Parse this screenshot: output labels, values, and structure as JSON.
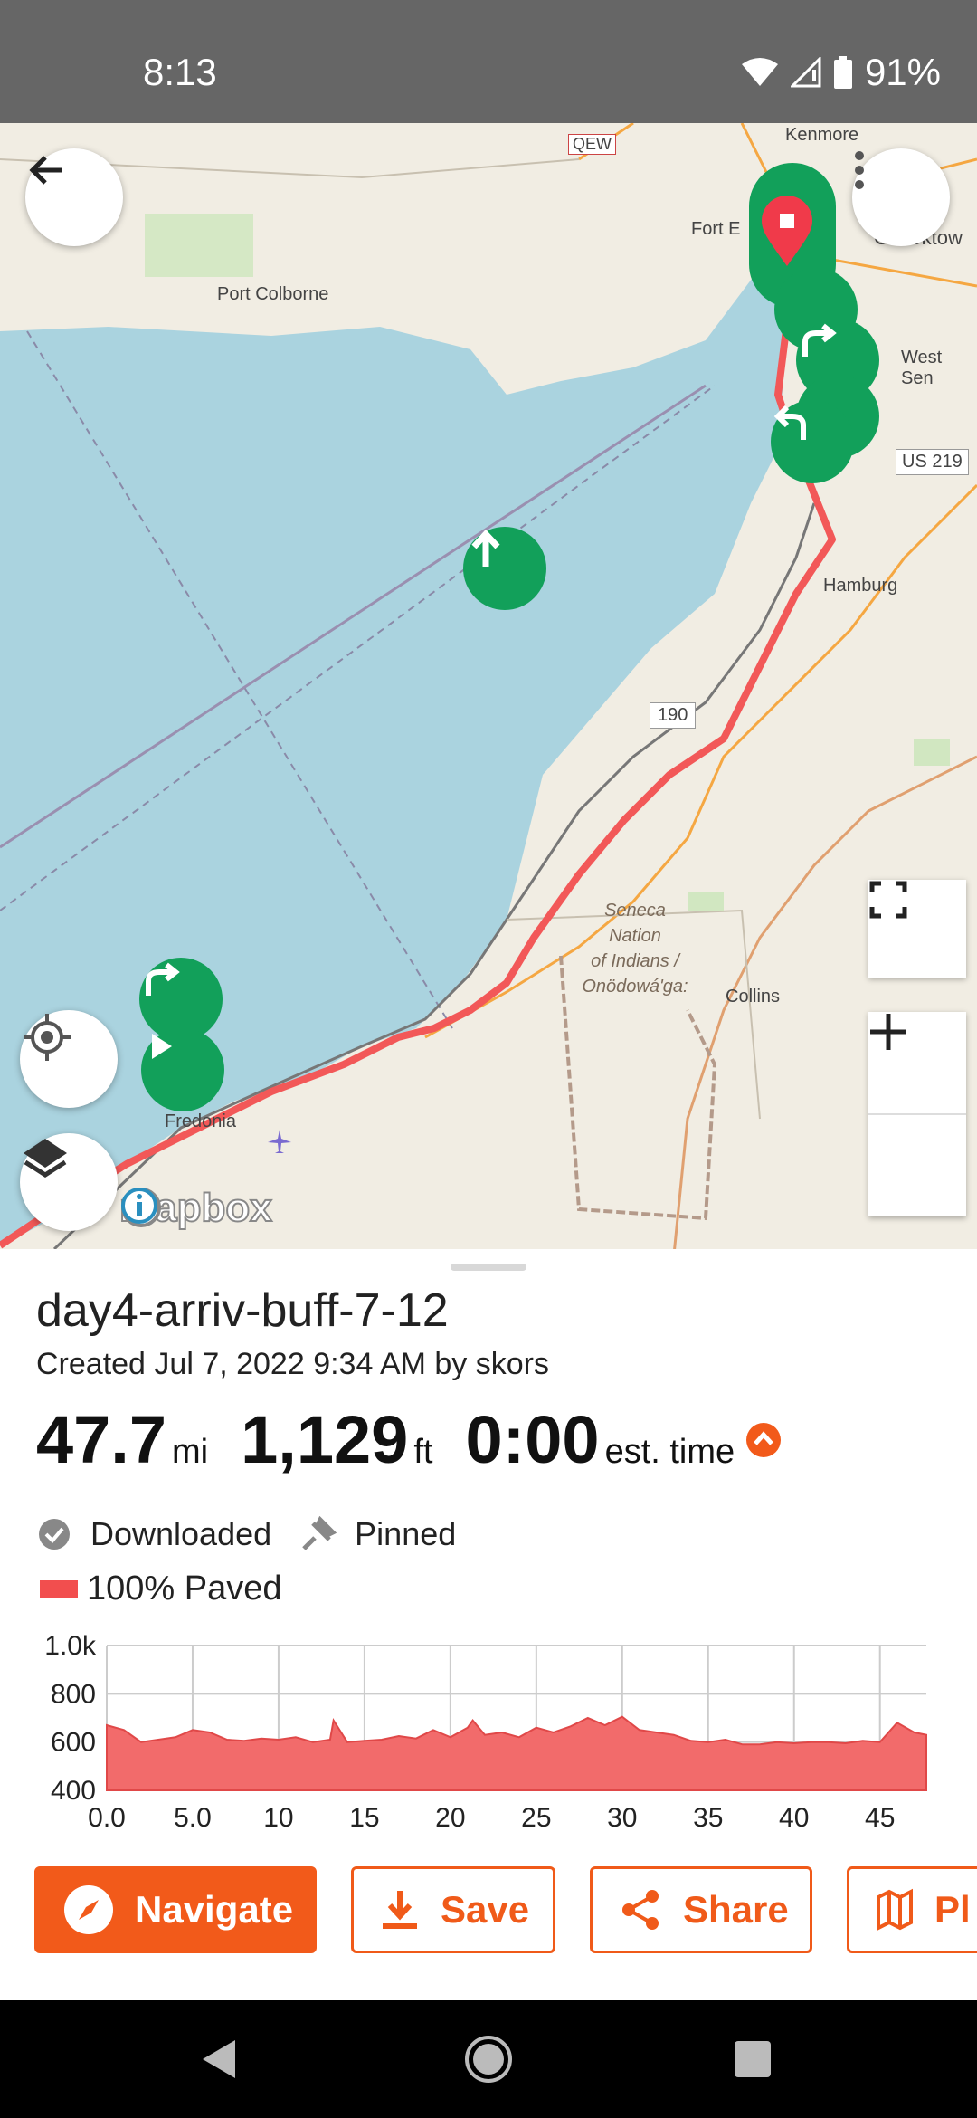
{
  "status": {
    "time": "8:13",
    "battery": "91%"
  },
  "map": {
    "labels": {
      "kenmore": "Kenmore",
      "qew": "QEW",
      "fort_erie": "Fort E",
      "cheektowaga": "Cheektow",
      "port_colborne": "Port Colborne",
      "west_seneca": "West Sen",
      "us219": "US 219",
      "hamburg": "Hamburg",
      "i190": "190",
      "seneca_nation": [
        "Seneca",
        "Nation",
        "of Indians /",
        "Onödowá'ga:"
      ],
      "collins": "Collins",
      "fredonia": "Fredonia",
      "mapbox": "mapbox"
    },
    "colors": {
      "water": "#aad3df",
      "land": "#f1ede3",
      "route": "#f25858",
      "marker": "#12a05a"
    }
  },
  "route": {
    "title": "day4-arriv-buff-7-12",
    "created": "Created Jul 7, 2022 9:34 AM by skors",
    "distance": "47.7",
    "distance_unit": "mi",
    "elevation": "1,129",
    "elevation_unit": "ft",
    "time": "0:00",
    "time_label": "est. time",
    "downloaded": "Downloaded",
    "pinned": "Pinned",
    "paved": "100% Paved"
  },
  "chart_data": {
    "type": "area",
    "ylim": [
      400,
      1000
    ],
    "xlim": [
      0,
      47.7
    ],
    "yticks": [
      "1.0k",
      "800",
      "600",
      "400"
    ],
    "xticks": [
      "0.0",
      "5.0",
      "10",
      "15",
      "20",
      "25",
      "30",
      "35",
      "40",
      "45"
    ],
    "x": [
      0,
      1,
      2,
      3,
      4,
      5,
      6,
      7,
      8,
      9,
      10,
      11,
      12,
      13,
      13.2,
      14,
      15,
      16,
      17,
      18,
      19,
      20,
      21,
      21.3,
      22,
      23,
      24,
      25,
      26,
      27,
      28,
      29,
      30,
      31,
      32,
      33,
      34,
      35,
      36,
      37,
      38,
      39,
      40,
      41,
      42,
      43,
      44,
      45,
      46,
      47,
      47.7
    ],
    "y": [
      670,
      650,
      600,
      610,
      620,
      650,
      640,
      610,
      605,
      615,
      610,
      620,
      600,
      610,
      690,
      600,
      605,
      610,
      625,
      615,
      650,
      620,
      660,
      690,
      630,
      640,
      620,
      660,
      640,
      665,
      700,
      670,
      705,
      650,
      640,
      630,
      605,
      600,
      610,
      590,
      590,
      600,
      595,
      600,
      600,
      595,
      605,
      600,
      680,
      640,
      630
    ],
    "color": "#f26b6b"
  },
  "buttons": {
    "navigate": "Navigate",
    "save": "Save",
    "share": "Share",
    "plan": "Pl"
  }
}
